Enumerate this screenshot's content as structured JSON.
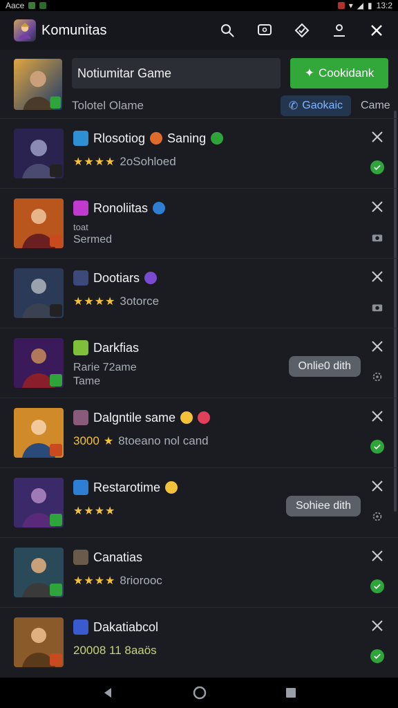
{
  "status": {
    "left": "Aace",
    "time": "13:2"
  },
  "appbar": {
    "title": "Komunitas"
  },
  "hero": {
    "input_value": "Notiumitar Game",
    "green_button": "Cookidank",
    "subtitle": "Tolotel Olame",
    "chip": "Gaokaic",
    "game_label": "Came"
  },
  "items": [
    {
      "name": "Rlosotiog",
      "name2": "Saning",
      "meta": "2oSohloed",
      "stars": "★★★★",
      "status": "ok",
      "pill": ""
    },
    {
      "name": "Ronoliitas",
      "name2": "",
      "meta_line1": "toat",
      "meta_line2": "Sermed",
      "status": "camera",
      "pill": ""
    },
    {
      "name": "Dootiars",
      "name2": "",
      "meta": "3otorce",
      "stars": "★★★★",
      "status": "camera",
      "pill": ""
    },
    {
      "name": "Darkfias",
      "name2": "",
      "meta_line1": "Rarie 72ame",
      "meta_line2": "Tame",
      "status": "settings",
      "pill": "Onlie0 dith"
    },
    {
      "name": "Dalgntile same",
      "name2": "",
      "meta": "8toeano nol cand",
      "prefix": "3000",
      "stars": "★",
      "status": "ok",
      "pill": ""
    },
    {
      "name": "Restarotime",
      "name2": "",
      "meta": "",
      "stars": "★★★★",
      "status": "settings",
      "pill": "Sohiee dith"
    },
    {
      "name": "Canatias",
      "name2": "",
      "meta": "8riorooc",
      "stars": "★★★★",
      "status": "ok",
      "pill": ""
    },
    {
      "name": "Dakatiabcol",
      "name2": "",
      "meta": "20008 11 8aaös",
      "status": "ok",
      "pill": ""
    }
  ],
  "colors": {
    "accent_green": "#32a83a",
    "chip_blue": "#7fb6ff",
    "star": "#f3c13a"
  }
}
